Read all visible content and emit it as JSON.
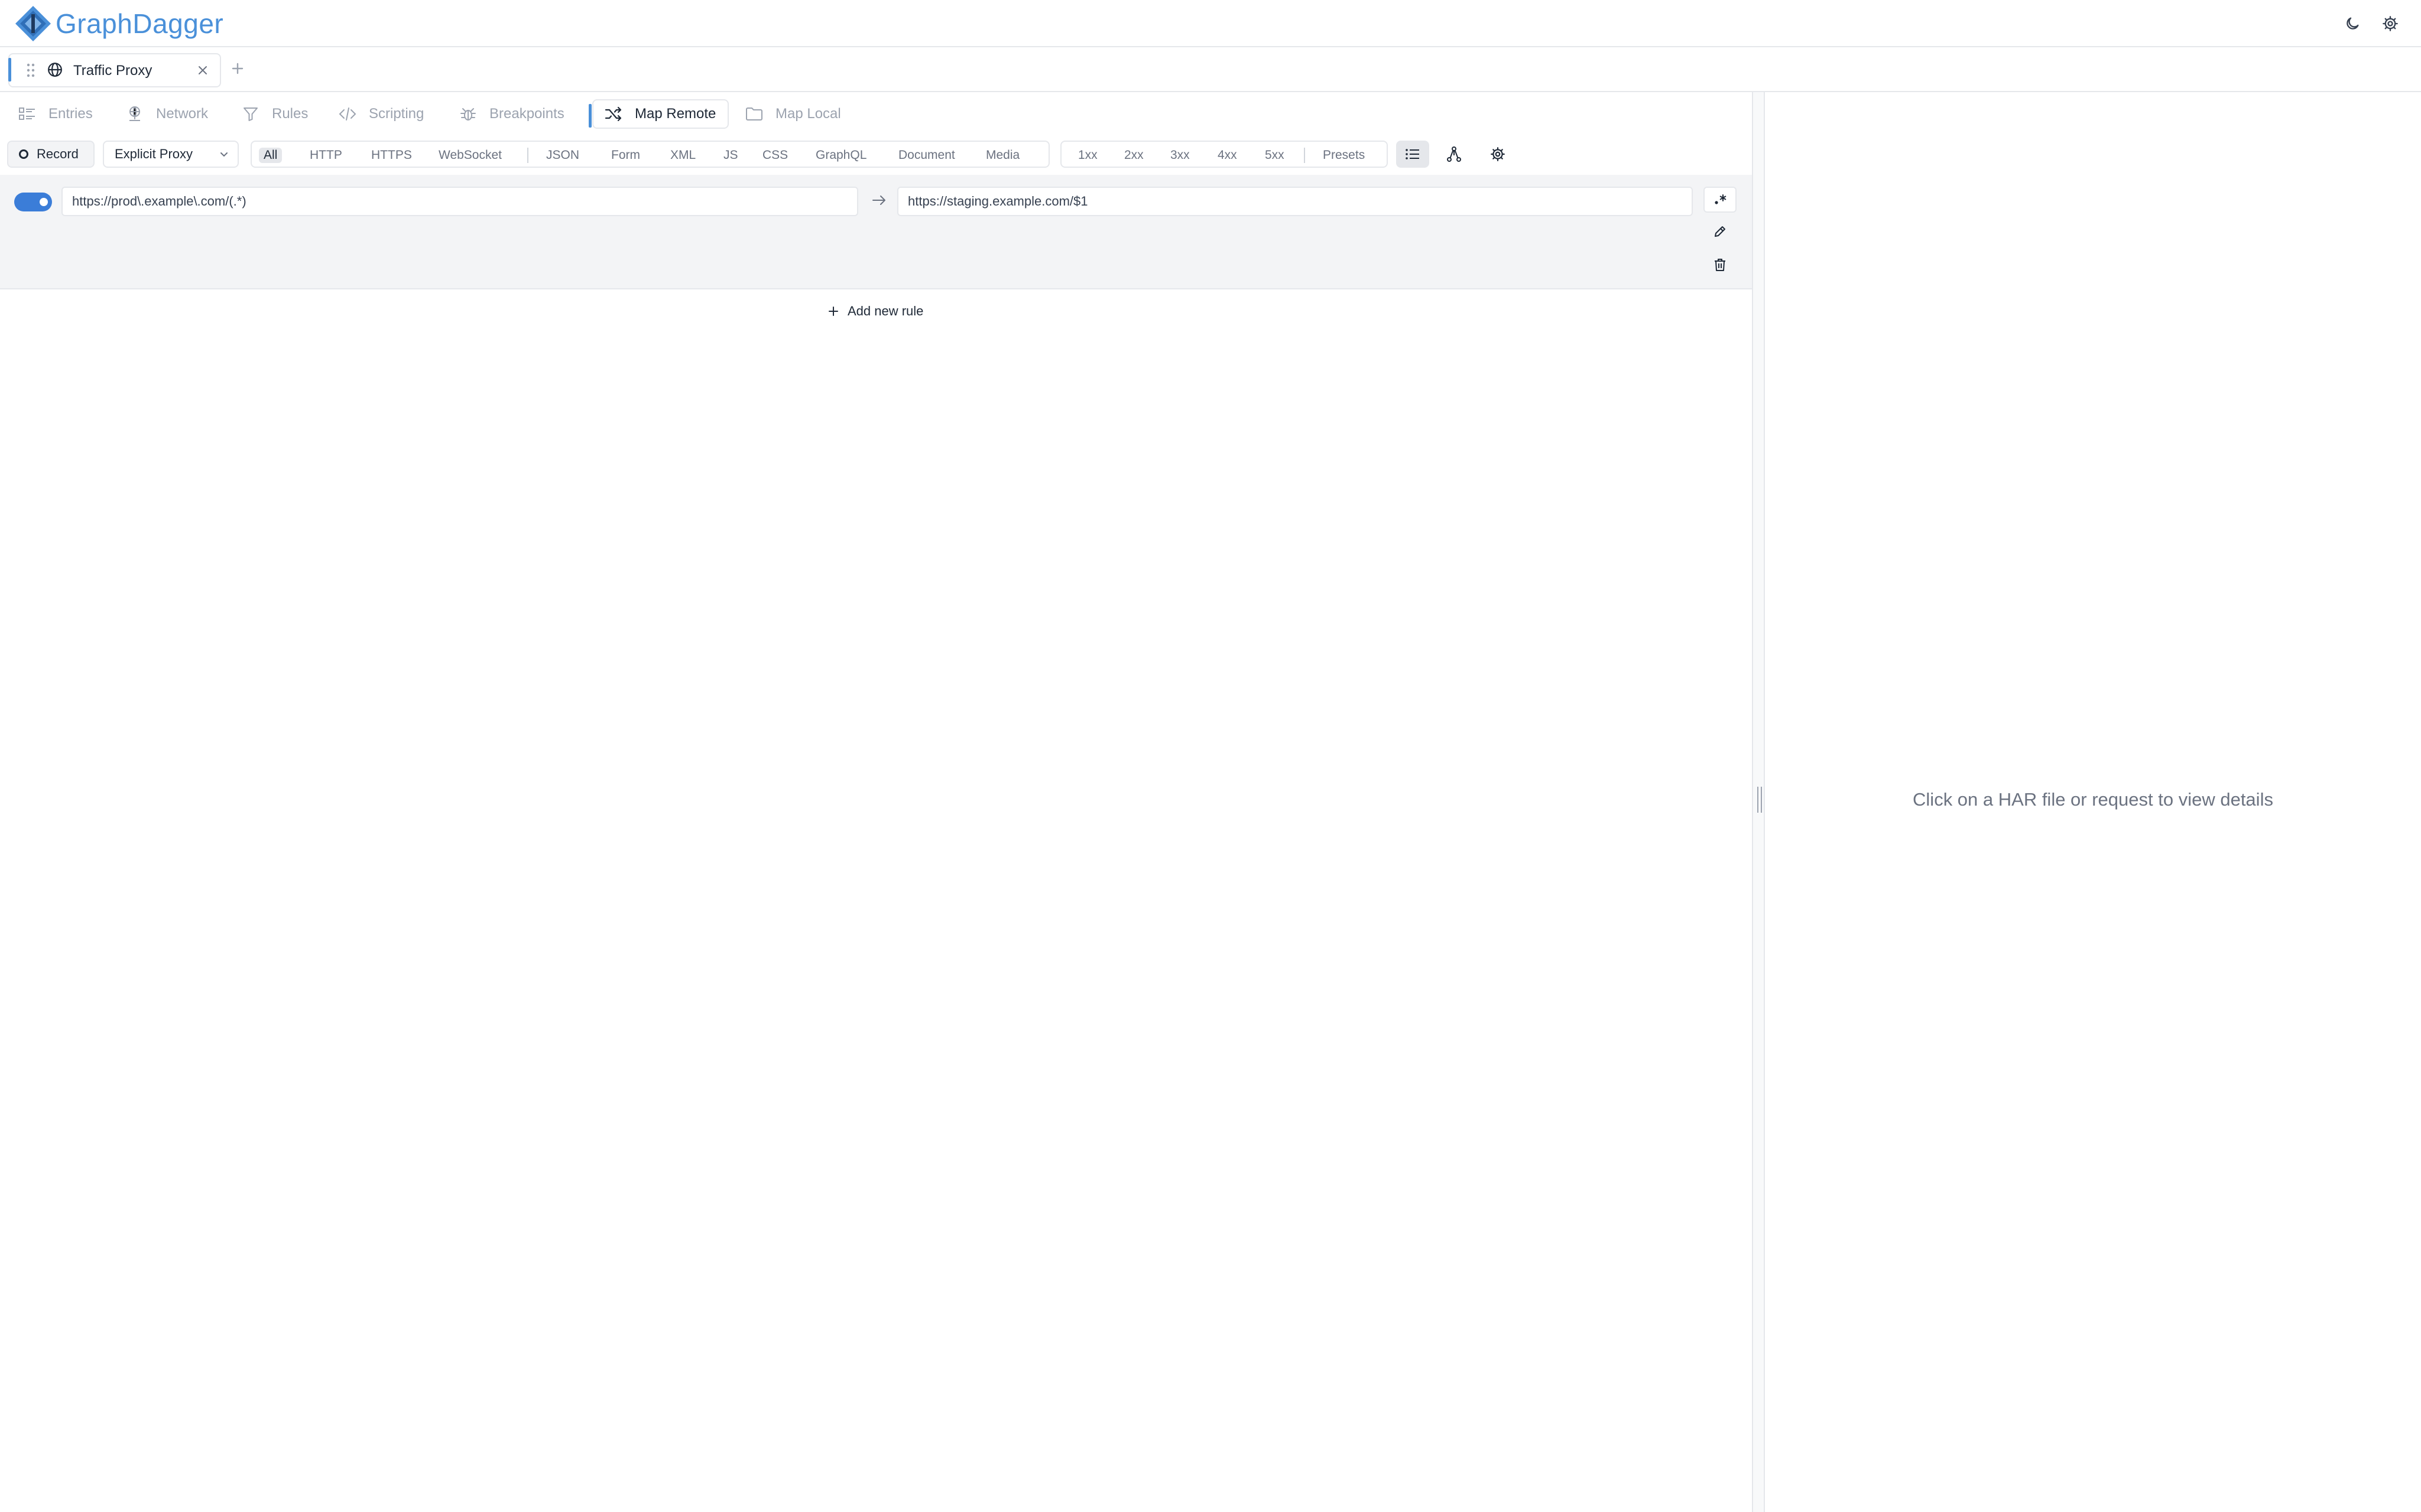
{
  "header": {
    "brand": "GraphDagger",
    "icons": {
      "theme": "moon-icon",
      "settings": "gear-icon"
    }
  },
  "session_tabs": [
    {
      "label": "Traffic Proxy",
      "icon": "globe-icon",
      "active": true
    }
  ],
  "tool_tabs": [
    {
      "label": "Entries",
      "icon": "entries-icon",
      "active": false
    },
    {
      "label": "Network",
      "icon": "network-icon",
      "active": false
    },
    {
      "label": "Rules",
      "icon": "filter-icon",
      "active": false
    },
    {
      "label": "Scripting",
      "icon": "code-icon",
      "active": false
    },
    {
      "label": "Breakpoints",
      "icon": "bug-icon",
      "active": false
    },
    {
      "label": "Map Remote",
      "icon": "shuffle-icon",
      "active": true
    },
    {
      "label": "Map Local",
      "icon": "folder-icon",
      "active": false
    }
  ],
  "toolbar": {
    "record_label": "Record",
    "proxy_mode": "Explicit Proxy",
    "type_filters": [
      "All",
      "HTTP",
      "HTTPS",
      "WebSocket",
      "JSON",
      "Form",
      "XML",
      "JS",
      "CSS",
      "GraphQL",
      "Document",
      "Media"
    ],
    "type_filter_selected": "All",
    "status_filters": [
      "1xx",
      "2xx",
      "3xx",
      "4xx",
      "5xx",
      "Presets"
    ]
  },
  "map_remote": {
    "rules": [
      {
        "enabled": true,
        "from": "https://prod\\.example\\.com/(.*)",
        "to": "https://staging.example.com/$1"
      }
    ],
    "add_rule_label": "Add new rule"
  },
  "details_panel": {
    "empty_message": "Click on a HAR file or request to view details"
  },
  "colors": {
    "accent": "#4a90d9",
    "toggle_on": "#3b7dd8",
    "border": "#e5e7eb",
    "muted_text": "#9ca3af"
  }
}
